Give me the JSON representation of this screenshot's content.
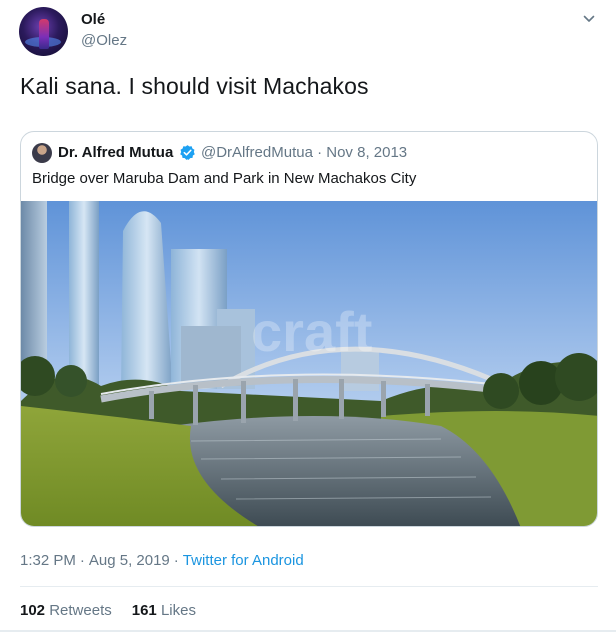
{
  "author": {
    "display_name": "Olé",
    "handle": "@Olez"
  },
  "tweet": {
    "text": "Kali sana. I should visit Machakos"
  },
  "quoted_tweet": {
    "display_name": "Dr. Alfred Mutua",
    "verified": true,
    "handle_date": "@DrAlfredMutua · Nov 8, 2013",
    "text": "Bridge over Maruba Dam and Park in New Machakos City",
    "image_watermark": "craft"
  },
  "meta": {
    "time": "1:32 PM",
    "separator": "·",
    "date": "Aug 5, 2019",
    "source": "Twitter for Android"
  },
  "stats": {
    "retweets_count": "102",
    "retweets_label": "Retweets",
    "likes_count": "161",
    "likes_label": "Likes"
  },
  "colors": {
    "accent": "#1b95e0",
    "secondary_text": "#657786",
    "border": "#ccd6dd",
    "verified_badge": "#1da1f2"
  },
  "icons": {
    "more": "chevron-down-icon",
    "verified": "verified-badge-icon"
  }
}
